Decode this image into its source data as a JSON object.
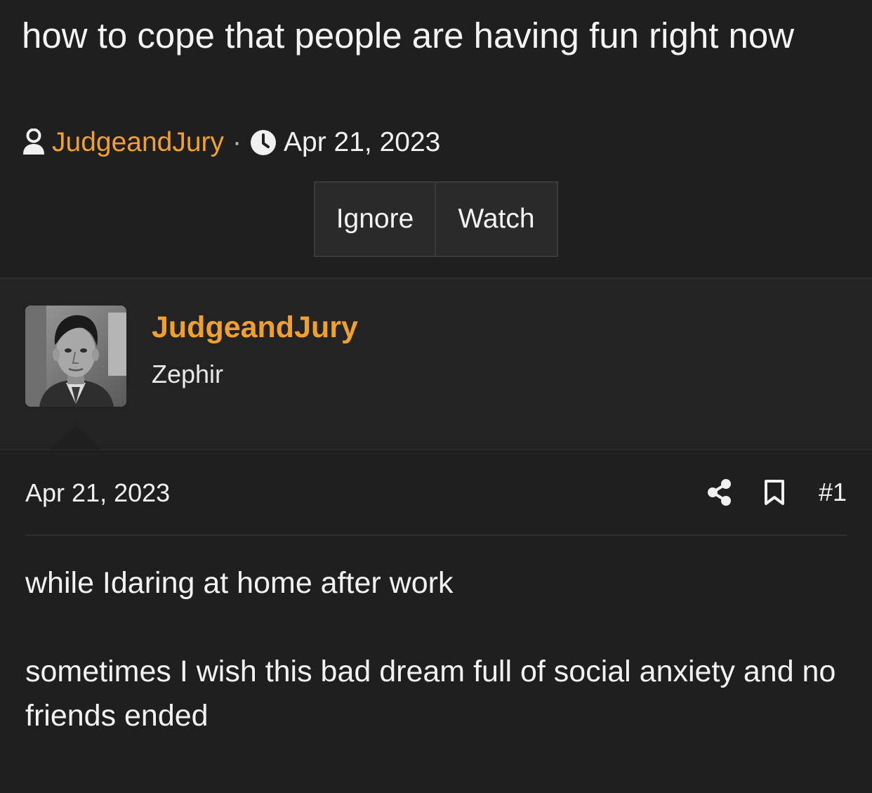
{
  "thread": {
    "title": "how to cope that people are having fun right now",
    "author": "JudgeandJury",
    "separator": "·",
    "date": "Apr 21, 2023",
    "buttons": {
      "ignore": "Ignore",
      "watch": "Watch"
    }
  },
  "post": {
    "author_name": "JudgeandJury",
    "author_title": "Zephir",
    "date": "Apr 21, 2023",
    "number": "#1",
    "paragraphs": [
      "while Idaring at home after work",
      "sometimes I wish this bad dream full of social anxiety and no friends ended"
    ]
  },
  "icons": {
    "user": "user-icon",
    "clock": "clock-icon",
    "share": "share-icon",
    "bookmark": "bookmark-icon"
  },
  "colors": {
    "accent": "#f0a030",
    "background": "#1f1f1f",
    "panel": "#232323",
    "button": "#2a2a2a"
  }
}
